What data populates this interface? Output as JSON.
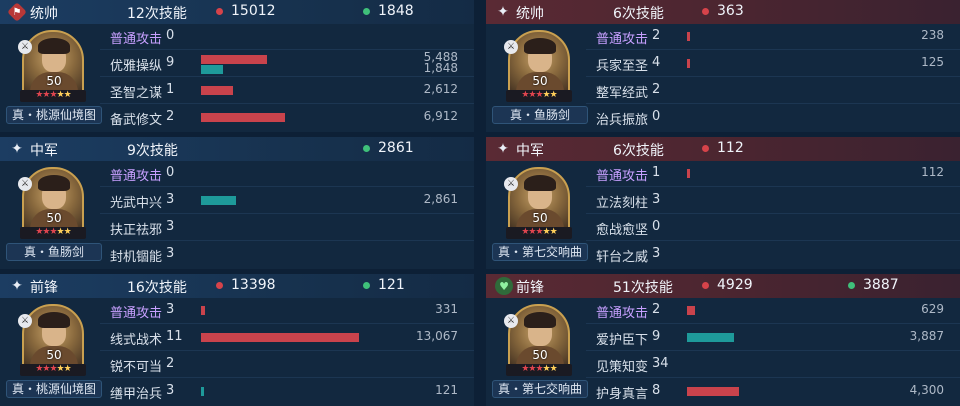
{
  "left": {
    "commander": {
      "role": "统帅",
      "role_icon": "flag-icon",
      "skills_used": "12次技能",
      "damage": "15012",
      "heal": "1848",
      "level": "50",
      "weapon": "真・桃源仙境图",
      "skills": [
        {
          "name": "普通攻击",
          "count": "0",
          "bars": [],
          "values": []
        },
        {
          "name": "优雅操纵",
          "count": "9",
          "bars": [
            {
              "type": "red",
              "v": 5488
            },
            {
              "type": "teal",
              "v": 1848
            }
          ],
          "values": [
            "5,488",
            "1,848"
          ]
        },
        {
          "name": "圣智之谋",
          "count": "1",
          "bars": [
            {
              "type": "red",
              "v": 2612
            }
          ],
          "values": [
            "2,612"
          ]
        },
        {
          "name": "备武修文",
          "count": "2",
          "bars": [
            {
              "type": "red",
              "v": 6912
            }
          ],
          "values": [
            "6,912"
          ]
        }
      ]
    },
    "middle": {
      "role": "中军",
      "role_icon": "sparkle-icon",
      "skills_used": "9次技能",
      "heal": "2861",
      "level": "50",
      "weapon": "真・鱼肠剑",
      "skills": [
        {
          "name": "普通攻击",
          "count": "0",
          "bars": [],
          "values": []
        },
        {
          "name": "光武中兴",
          "count": "3",
          "bars": [
            {
              "type": "teal",
              "v": 2861
            }
          ],
          "values": [
            "2,861"
          ]
        },
        {
          "name": "扶正祛邪",
          "count": "3",
          "bars": [],
          "values": []
        },
        {
          "name": "封机锢能",
          "count": "3",
          "bars": [],
          "values": []
        }
      ]
    },
    "vanguard": {
      "role": "前锋",
      "role_icon": "sparkle-icon",
      "skills_used": "16次技能",
      "damage": "13398",
      "heal": "121",
      "level": "50",
      "weapon": "真・桃源仙境图",
      "skills": [
        {
          "name": "普通攻击",
          "count": "3",
          "bars": [
            {
              "type": "red",
              "v": 331
            }
          ],
          "values": [
            "331"
          ]
        },
        {
          "name": "线式战术",
          "count": "11",
          "bars": [
            {
              "type": "red",
              "v": 13067
            }
          ],
          "values": [
            "13,067"
          ]
        },
        {
          "name": "锐不可当",
          "count": "2",
          "bars": [],
          "values": []
        },
        {
          "name": "缮甲治兵",
          "count": "3",
          "bars": [
            {
              "type": "teal",
              "v": 121
            }
          ],
          "values": [
            "121"
          ]
        }
      ]
    }
  },
  "right": {
    "commander": {
      "role": "统帅",
      "role_icon": "sparkle-icon",
      "skills_used": "6次技能",
      "damage": "363",
      "level": "50",
      "weapon": "真・鱼肠剑",
      "skills": [
        {
          "name": "普通攻击",
          "count": "2",
          "bars": [
            {
              "type": "red",
              "v": 238
            }
          ],
          "values": [
            "238"
          ]
        },
        {
          "name": "兵家至圣",
          "count": "4",
          "bars": [
            {
              "type": "red",
              "v": 125
            }
          ],
          "values": [
            "125"
          ]
        },
        {
          "name": "整军经武",
          "count": "2",
          "bars": [],
          "values": []
        },
        {
          "name": "治兵振旅",
          "count": "0",
          "bars": [],
          "values": []
        }
      ]
    },
    "middle": {
      "role": "中军",
      "role_icon": "sparkle-icon",
      "skills_used": "6次技能",
      "damage": "112",
      "level": "50",
      "weapon": "真・第七交响曲",
      "skills": [
        {
          "name": "普通攻击",
          "count": "1",
          "bars": [
            {
              "type": "red",
              "v": 112
            }
          ],
          "values": [
            "112"
          ]
        },
        {
          "name": "立法刻柱",
          "count": "3",
          "bars": [],
          "values": []
        },
        {
          "name": "愈战愈坚",
          "count": "0",
          "bars": [],
          "values": []
        },
        {
          "name": "轩台之威",
          "count": "3",
          "bars": [],
          "values": []
        }
      ]
    },
    "vanguard": {
      "role": "前锋",
      "role_icon": "heart-icon",
      "skills_used": "51次技能",
      "damage": "4929",
      "heal": "3887",
      "level": "50",
      "weapon": "真・第七交响曲",
      "skills": [
        {
          "name": "普通攻击",
          "count": "2",
          "bars": [
            {
              "type": "red",
              "v": 629
            }
          ],
          "values": [
            "629"
          ]
        },
        {
          "name": "爱护臣下",
          "count": "9",
          "bars": [
            {
              "type": "teal",
              "v": 3887
            }
          ],
          "values": [
            "3,887"
          ]
        },
        {
          "name": "见策知变",
          "count": "34",
          "bars": [],
          "values": []
        },
        {
          "name": "护身真言",
          "count": "8",
          "bars": [
            {
              "type": "red",
              "v": 4300
            }
          ],
          "values": [
            "4,300"
          ]
        }
      ]
    }
  },
  "bar_scale_max": 13067,
  "colors": {
    "damage": "#c9434c",
    "heal": "#1e9a9a",
    "enemy_header": "#5a2a34",
    "ally_header": "#1c3d62"
  }
}
